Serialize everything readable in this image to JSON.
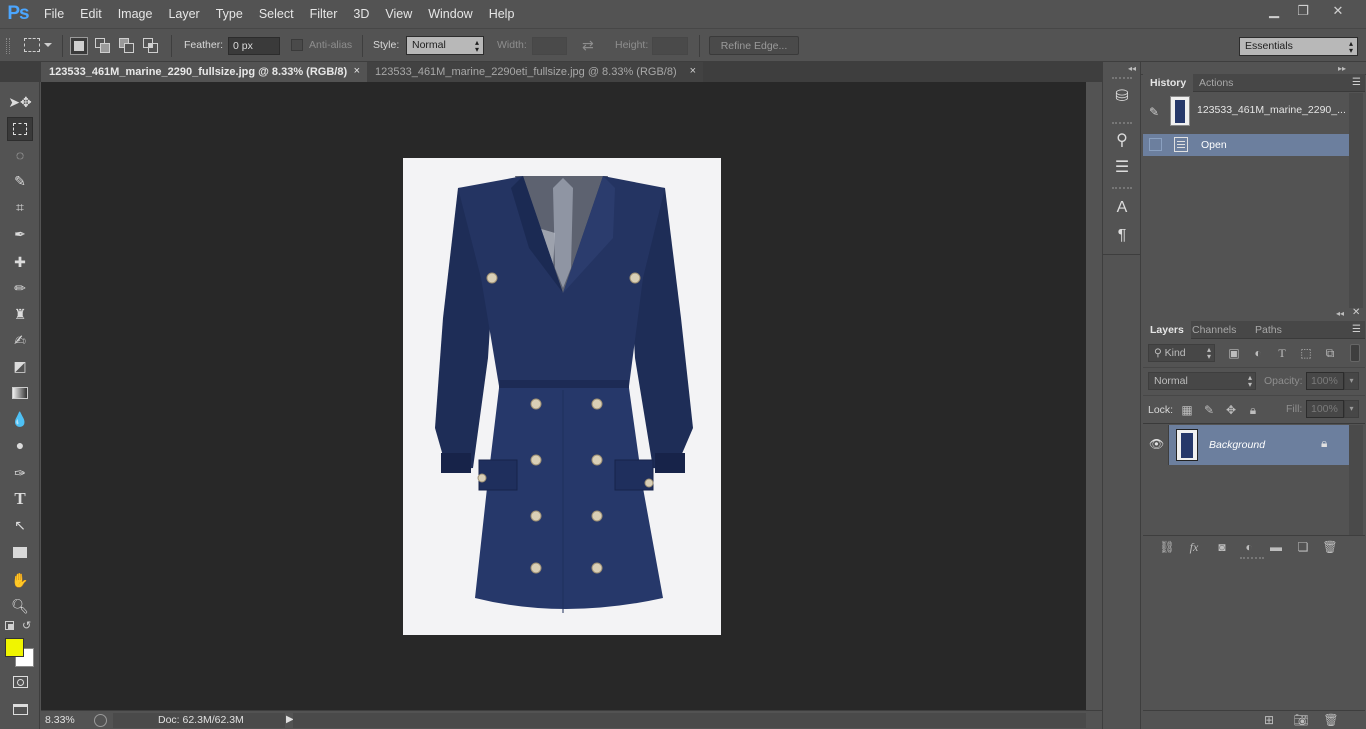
{
  "app": {
    "logo": "Ps"
  },
  "menu": [
    "File",
    "Edit",
    "Image",
    "Layer",
    "Type",
    "Select",
    "Filter",
    "3D",
    "View",
    "Window",
    "Help"
  ],
  "window_controls": {
    "minimize": "▁",
    "restore": "❐",
    "close": "✕"
  },
  "options": {
    "feather_label": "Feather:",
    "feather_value": "0 px",
    "antialias_label": "Anti-alias",
    "style_label": "Style:",
    "style_value": "Normal",
    "width_label": "Width:",
    "height_label": "Height:",
    "refine_edge": "Refine Edge...",
    "workspace": "Essentials"
  },
  "tabs": [
    {
      "label": "123533_461M_marine_2290_fullsize.jpg @ 8.33% (RGB/8)",
      "close": "×",
      "active": true
    },
    {
      "label": "123533_461M_marine_2290eti_fullsize.jpg @ 8.33% (RGB/8)",
      "close": "×",
      "active": false
    }
  ],
  "colors": {
    "foreground": "#f0f500",
    "background": "#ffffff",
    "accent_selection": "#6c7f9e",
    "canvas": "#282828"
  },
  "status": {
    "zoom": "8.33%",
    "doc": "Doc: 62.3M/62.3M"
  },
  "history_panel": {
    "tabs": [
      "History",
      "Actions"
    ],
    "snapshot_label": "123533_461M_marine_2290_...",
    "states": [
      "Open"
    ]
  },
  "layers_panel": {
    "tabs": [
      "Layers",
      "Channels",
      "Paths"
    ],
    "filter_kind": "Kind",
    "blend_mode": "Normal",
    "opacity_label": "Opacity:",
    "opacity_value": "100%",
    "lock_label": "Lock:",
    "fill_label": "Fill:",
    "fill_value": "100%",
    "layers": [
      {
        "name": "Background",
        "visible": true,
        "locked": true
      }
    ]
  }
}
